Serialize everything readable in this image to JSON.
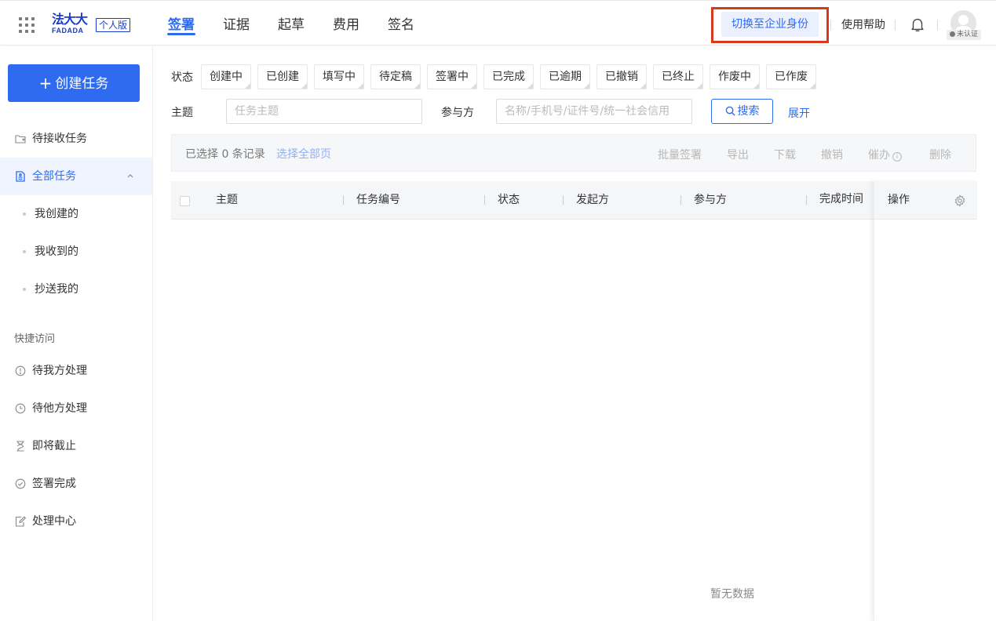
{
  "header": {
    "logo_cn": "法大大",
    "logo_en": "FADADA",
    "edition": "个人版",
    "nav": [
      "签署",
      "证据",
      "起草",
      "费用",
      "签名"
    ],
    "active_nav": "签署",
    "switch_identity": "切换至企业身份",
    "help": "使用帮助",
    "avatar_badge": "未认证"
  },
  "sidebar": {
    "create_button": "创建任务",
    "pending_receive": "待接收任务",
    "all_tasks": "全部任务",
    "sub_items": [
      "我创建的",
      "我收到的",
      "抄送我的"
    ],
    "quick_access_label": "快捷访问",
    "quick_items": [
      "待我方处理",
      "待他方处理",
      "即将截止",
      "签署完成",
      "处理中心"
    ]
  },
  "filters": {
    "status_label": "状态",
    "statuses": [
      "创建中",
      "已创建",
      "填写中",
      "待定稿",
      "签署中",
      "已完成",
      "已逾期",
      "已撤销",
      "已终止",
      "作废中",
      "已作废"
    ],
    "subject_label": "主题",
    "subject_placeholder": "任务主题",
    "participant_label": "参与方",
    "participant_placeholder": "名称/手机号/证件号/统一社会信用",
    "search_button": "搜索",
    "expand": "展开"
  },
  "batch": {
    "selected_text": "已选择 0 条记录",
    "select_all": "选择全部页",
    "actions": [
      "批量签署",
      "导出",
      "下载",
      "撤销",
      "催办",
      "删除"
    ]
  },
  "table": {
    "columns": [
      "主题",
      "任务编号",
      "状态",
      "发起方",
      "参与方",
      "完成时间"
    ],
    "operation_column": "操作",
    "empty_text": "暂无数据"
  }
}
